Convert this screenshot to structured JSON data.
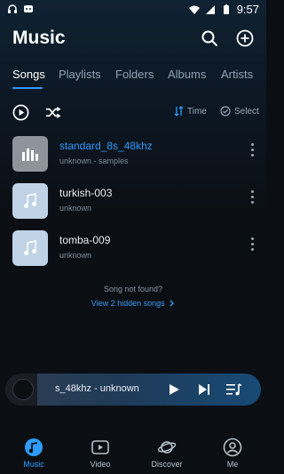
{
  "status_bar": {
    "time": "9:57"
  },
  "header": {
    "title": "Music"
  },
  "tabs": [
    {
      "label": "Songs",
      "active": true
    },
    {
      "label": "Playlists"
    },
    {
      "label": "Folders"
    },
    {
      "label": "Albums"
    },
    {
      "label": "Artists"
    }
  ],
  "toolbar": {
    "sort_label": "Time",
    "select_label": "Select"
  },
  "songs": [
    {
      "title": "standard_8s_48khz",
      "subtitle": "unknown - samples",
      "playing": true
    },
    {
      "title": "turkish-003",
      "subtitle": "unknown"
    },
    {
      "title": "tomba-009",
      "subtitle": "unknown"
    }
  ],
  "hidden": {
    "message": "Song not found?",
    "link": "View 2 hidden songs"
  },
  "player": {
    "now_playing": "s_48khz - unknown"
  },
  "nav": [
    {
      "label": "Music",
      "active": true
    },
    {
      "label": "Video"
    },
    {
      "label": "Discover"
    },
    {
      "label": "Me"
    }
  ],
  "colors": {
    "accent": "#2e9cff",
    "background": "#0b0f14"
  }
}
